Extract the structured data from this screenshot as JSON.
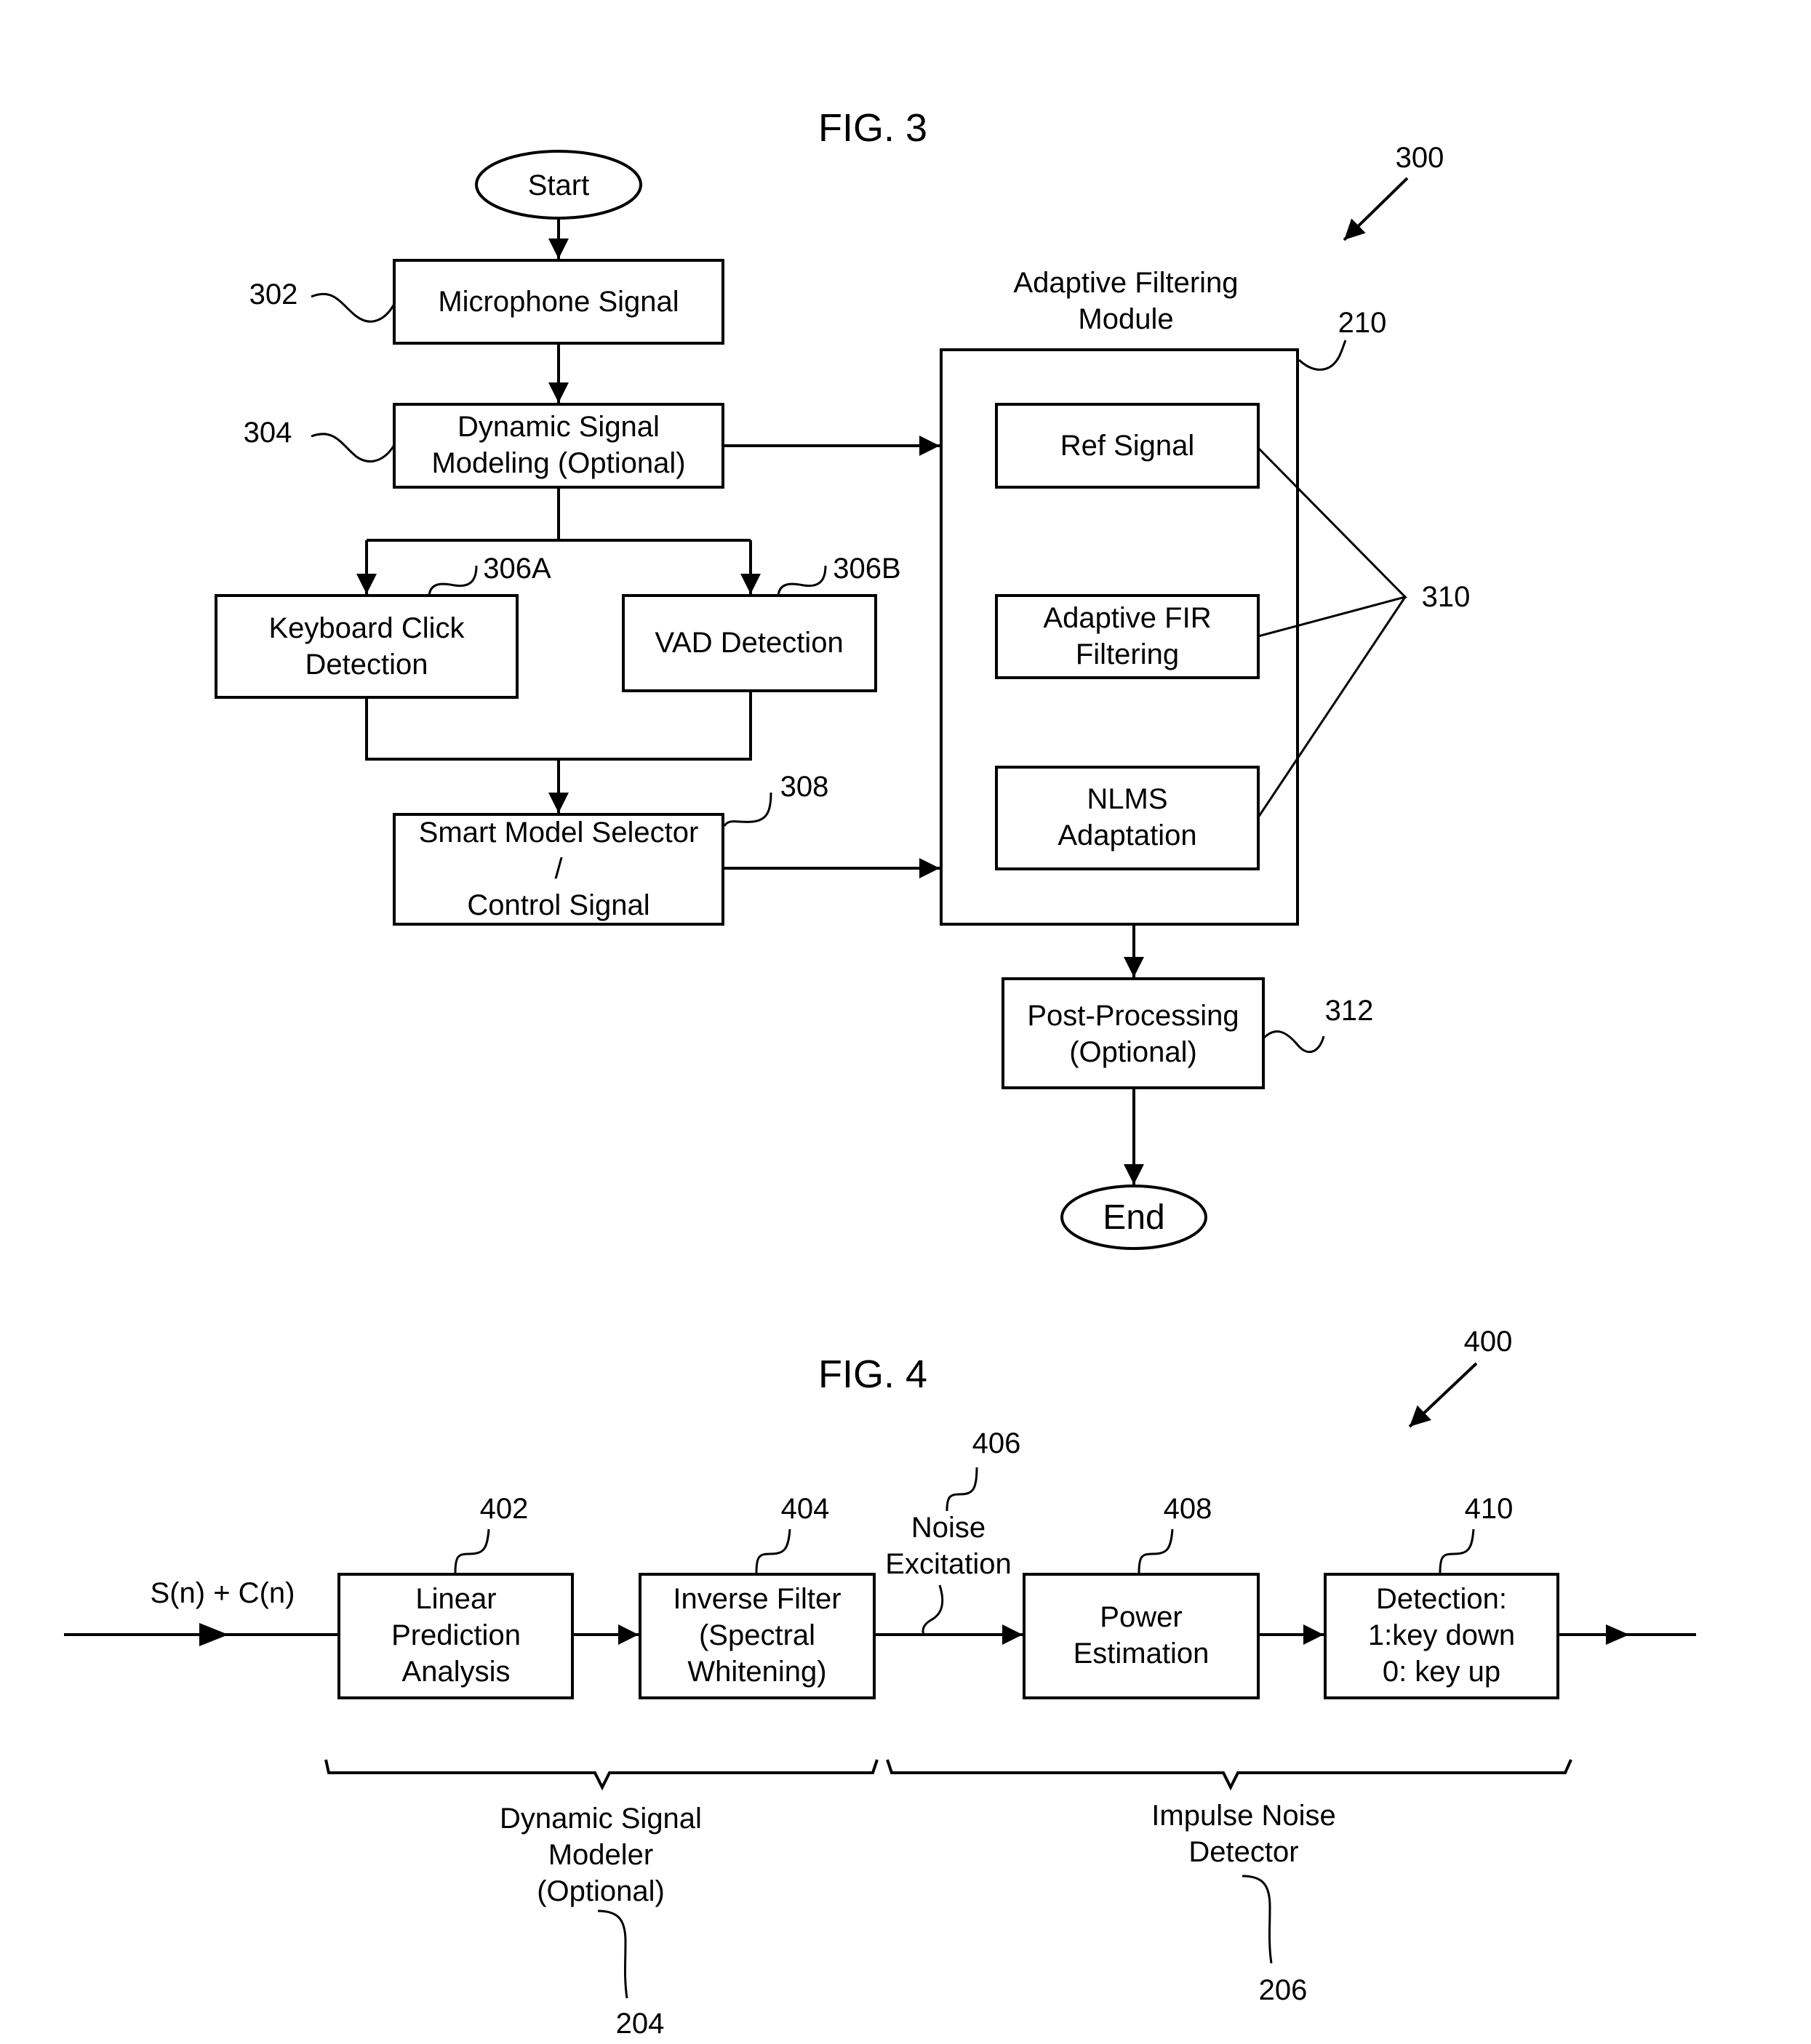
{
  "fig3": {
    "title": "FIG. 3",
    "figure_ref": "300",
    "start": "Start",
    "end": "End",
    "microphone": {
      "ref": "302",
      "label": "Microphone Signal"
    },
    "dynamic_modeling": {
      "ref": "304",
      "line1": "Dynamic Signal",
      "line2": "Modeling (Optional)"
    },
    "keyboard_click": {
      "ref": "306A",
      "line1": "Keyboard Click",
      "line2": "Detection"
    },
    "vad": {
      "ref": "306B",
      "label": "VAD Detection"
    },
    "smart_selector": {
      "ref": "308",
      "line1": "Smart Model Selector",
      "line2": "/",
      "line3": "Control Signal"
    },
    "adaptive_module": {
      "ref": "210",
      "title_line1": "Adaptive Filtering",
      "title_line2": "Module",
      "sub_ref": "310",
      "ref_signal": "Ref Signal",
      "fir_line1": "Adaptive FIR",
      "fir_line2": "Filtering",
      "nlms_line1": "NLMS",
      "nlms_line2": "Adaptation"
    },
    "post_processing": {
      "ref": "312",
      "line1": "Post-Processing",
      "line2": "(Optional)"
    }
  },
  "fig4": {
    "title": "FIG. 4",
    "figure_ref": "400",
    "input_label": "S(n) + C(n)",
    "lpa": {
      "ref": "402",
      "line1": "Linear",
      "line2": "Prediction",
      "line3": "Analysis"
    },
    "inverse_filter": {
      "ref": "404",
      "line1": "Inverse Filter",
      "line2": "(Spectral",
      "line3": "Whitening)"
    },
    "noise_excitation": {
      "ref": "406",
      "line1": "Noise",
      "line2": "Excitation"
    },
    "power": {
      "ref": "408",
      "line1": "Power",
      "line2": "Estimation"
    },
    "detection": {
      "ref": "410",
      "line1": "Detection:",
      "line2": "1:key down",
      "line3": "0: key up"
    },
    "modeler_group": {
      "ref": "204",
      "line1": "Dynamic Signal",
      "line2": "Modeler",
      "line3": "(Optional)"
    },
    "detector_group": {
      "ref": "206",
      "line1": "Impulse Noise",
      "line2": "Detector"
    }
  }
}
